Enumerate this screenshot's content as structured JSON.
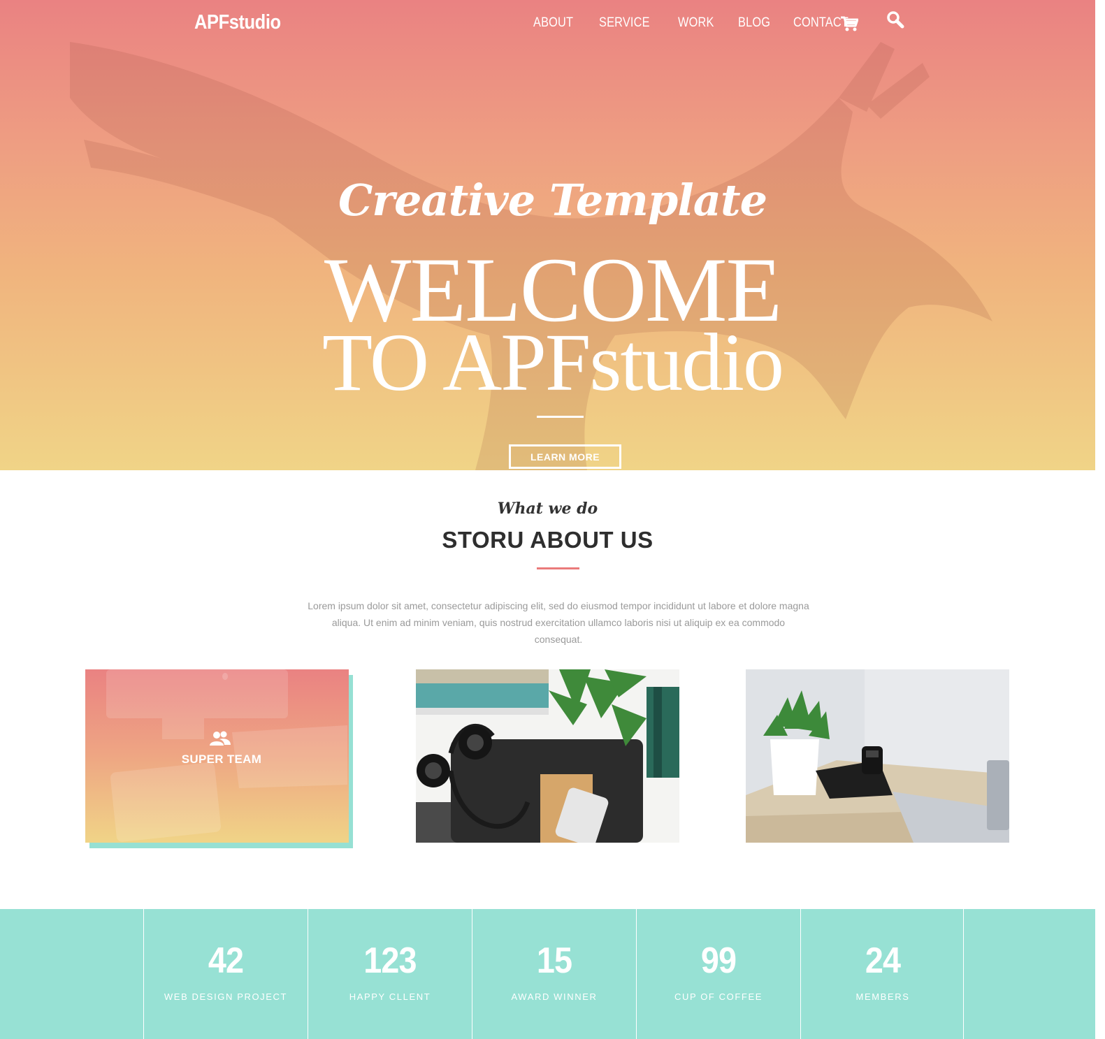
{
  "header": {
    "logo": "APFstudio",
    "nav": [
      "ABOUT",
      "SERVICE",
      "WORK",
      "BLOG",
      "CONTACT"
    ],
    "icons": [
      "cart-icon",
      "search-icon"
    ]
  },
  "hero": {
    "script_title": "Creative Template",
    "headline_line1": "WELCOME",
    "headline_line2": "TO APFstudio",
    "button": "LEARN MORE",
    "colors": {
      "gradient_top": "#ea8282",
      "gradient_bottom": "#f0d487"
    }
  },
  "about": {
    "script": "What we do",
    "title": "STORU ABOUT US",
    "text": "Lorem ipsum dolor sit amet, consectetur adipiscing elit, sed do eiusmod tempor incididunt ut labore et dolore magna aliqua. Ut enim ad minim veniam, quis nostrud exercitation ullamco laboris nisi ut aliquip ex ea commodo consequat.",
    "accent": "#ea7b7b"
  },
  "cards": [
    {
      "label": "SUPER TEAM",
      "icon": "users-icon"
    },
    {
      "label": "",
      "image": "desk-headphones-photo"
    },
    {
      "label": "",
      "image": "desk-plant-camera-photo"
    }
  ],
  "stats": {
    "background": "#97e1d4",
    "items": [
      {
        "number": "42",
        "label": "WEB DESIGN PROJECT"
      },
      {
        "number": "123",
        "label": "HAPPY CLLENT"
      },
      {
        "number": "15",
        "label": "AWARD WINNER"
      },
      {
        "number": "99",
        "label": "CUP OF COFFEE"
      },
      {
        "number": "24",
        "label": "MEMBERS"
      }
    ]
  }
}
